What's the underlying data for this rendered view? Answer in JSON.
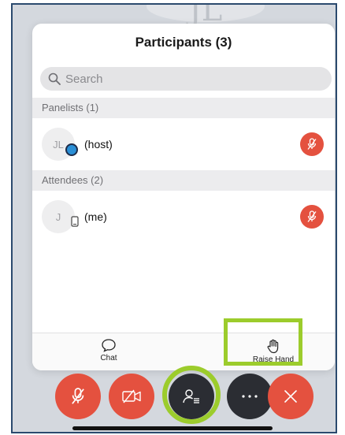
{
  "background": {
    "avatar_initials": "JL"
  },
  "panel": {
    "title": "Participants (3)",
    "search_placeholder": "Search",
    "sections": [
      {
        "header": "Panelists (1)",
        "participants": [
          {
            "initials": "JL",
            "name": "(host)",
            "role": "host",
            "muted": true
          }
        ]
      },
      {
        "header": "Attendees (2)",
        "participants": [
          {
            "initials": "J",
            "name": "(me)",
            "role": "attendee",
            "device": "phone",
            "muted": true
          }
        ]
      }
    ],
    "footer": {
      "chat_label": "Chat",
      "raise_hand_label": "Raise Hand"
    }
  },
  "toolbar": {
    "buttons": [
      {
        "icon": "microphone-muted-icon",
        "color": "#e4513f"
      },
      {
        "icon": "video-off-icon",
        "color": "#e4513f"
      },
      {
        "icon": "participants-icon",
        "color": "#2b2d33",
        "highlighted": true
      },
      {
        "icon": "more-icon",
        "color": "#2b2d33"
      },
      {
        "icon": "leave-icon",
        "color": "#e4513f"
      }
    ]
  },
  "colors": {
    "accent_red": "#e4513f",
    "highlight_green": "#9ccc2c",
    "toolbar_dark": "#2b2d33"
  }
}
